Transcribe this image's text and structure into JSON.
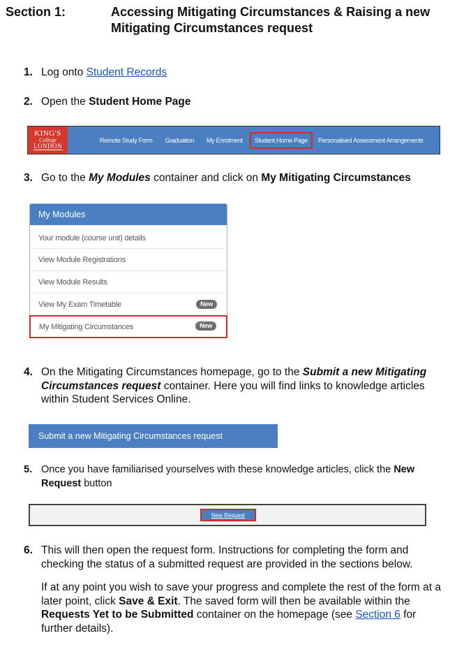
{
  "header": {
    "section_label": "Section 1:",
    "title": "Accessing Mitigating Circumstances & Raising a new Mitigating Circumstances request"
  },
  "steps": [
    {
      "num": "1.",
      "text": "Log onto ",
      "link": "Student Records"
    },
    {
      "num": "2.",
      "text": "Open the ",
      "bold": "Student Home Page"
    },
    {
      "num": "3.",
      "pre": "Go to the ",
      "bold_italic": "My Modules",
      "mid": " container and click on ",
      "bold": "My Mitigating Circumstances"
    },
    {
      "num": "4.",
      "pre": "On the Mitigating Circumstances homepage, go to the ",
      "bold_italic": "Submit a new Mitigating Circumstances request",
      "post": " container. Here you will find links to knowledge articles within Student Services Online."
    },
    {
      "num": "5.",
      "pre": "Once you have familiarised yourselves with these knowledge articles, click the ",
      "bold": "New Request",
      "post": " button"
    },
    {
      "num": "6.",
      "text": "This will then open the request form. Instructions for completing the form and checking the status of a submitted request are provided in the sections below."
    }
  ],
  "step6_para": {
    "pre": "If at any point you wish to save your progress and complete the rest of the form at a later point, click ",
    "bold1": "Save & Exit",
    "mid": ". The saved form will then be available within the ",
    "bold2": "Requests Yet to be Submitted",
    "post": " container on the homepage (see ",
    "link": "Section 6",
    "end": " for further details)."
  },
  "navbar": {
    "logo": {
      "line1": "KING'S",
      "line2": "College",
      "line3": "LONDON"
    },
    "items": [
      "Remote Study Form",
      "Graduation",
      "My Enrolment",
      "Student Home Page",
      "Personalised Assessment Arrangements"
    ],
    "highlighted": "Student Home Page"
  },
  "modules_panel": {
    "title": "My Modules",
    "rows": [
      {
        "label": "Your module (course unit) details",
        "badge": null
      },
      {
        "label": "View Module Registrations",
        "badge": null
      },
      {
        "label": "View Module Results",
        "badge": null
      },
      {
        "label": "View My Exam Timetable",
        "badge": "New"
      },
      {
        "label": "My Mitigating Circumstances",
        "badge": "New"
      }
    ],
    "highlighted": "My Mitigating Circumstances"
  },
  "submit_banner": {
    "title": "Submit a new Mitigating Circumstances request"
  },
  "new_request": {
    "button_label": "New Request"
  },
  "colors": {
    "brand_blue": "#4a7fc1",
    "highlight_red": "#d42a2a",
    "logo_red": "#d5382e",
    "link_blue": "#1a56c4"
  }
}
